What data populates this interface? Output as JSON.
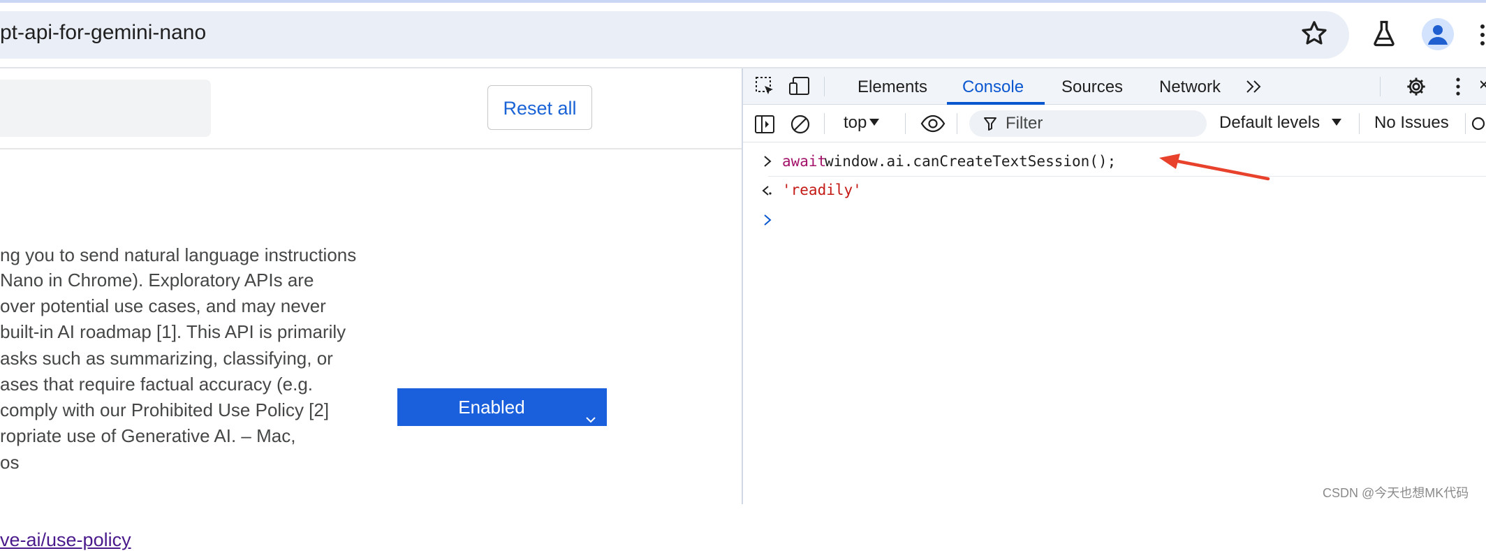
{
  "browser": {
    "url": "pt-api-for-gemini-nano"
  },
  "page": {
    "reset_label": "Reset all",
    "description_lines": [
      "ng you to send natural language instructions",
      "Nano in Chrome). Exploratory APIs are",
      "over potential use cases, and may never",
      "built-in AI roadmap [1]. This API is primarily",
      "asks such as summarizing, classifying, or",
      "ases that require factual accuracy (e.g.",
      " comply with our Prohibited Use Policy [2]",
      "ropriate use of Generative AI. – Mac,",
      "os"
    ],
    "select_value": "Enabled",
    "policy_link": "ve-ai/use-policy"
  },
  "devtools": {
    "tabs": [
      "Elements",
      "Console",
      "Sources",
      "Network"
    ],
    "active_tab": "Console",
    "toolbar": {
      "context": "top",
      "filter_placeholder": "Filter",
      "levels": "Default levels",
      "issues": "No Issues"
    },
    "console": {
      "input_keyword": "await",
      "input_rest": " window.ai.canCreateTextSession();",
      "result": "'readily'"
    },
    "accent_color": "#0b57d0",
    "annotation_color": "#e8412c"
  },
  "watermark": "CSDN @今天也想MK代码"
}
